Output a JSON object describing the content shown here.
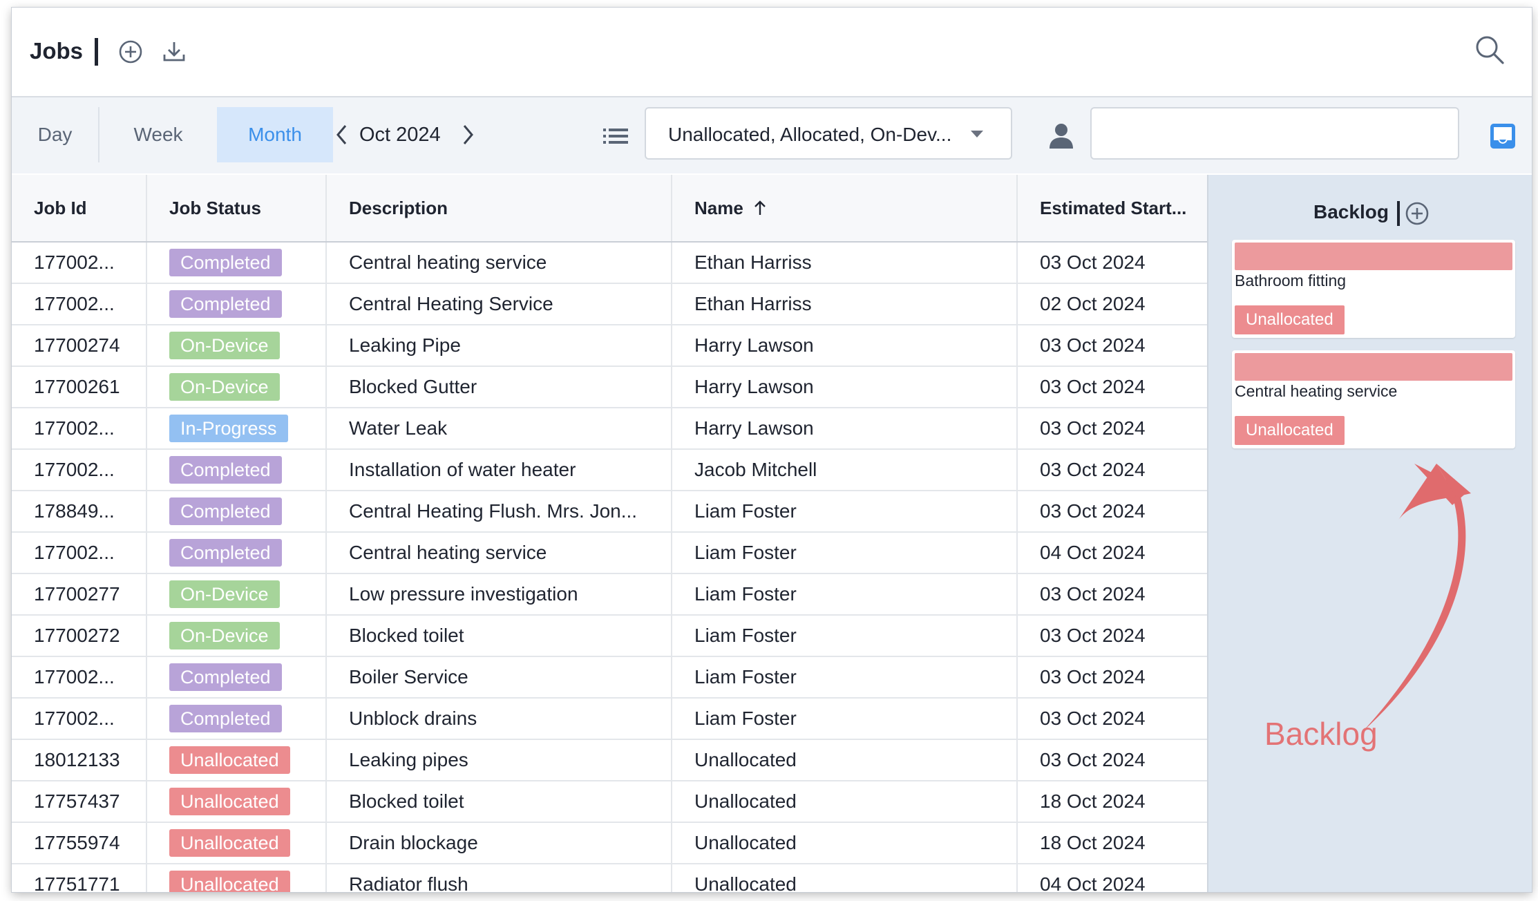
{
  "header": {
    "title": "Jobs",
    "icons": [
      "add-circle-icon",
      "download-icon",
      "search-icon"
    ]
  },
  "toolbar": {
    "views": [
      "Day",
      "Week",
      "Month"
    ],
    "selected_view": "Month",
    "period": "Oct 2024",
    "status_filter": "Unallocated, Allocated, On-Dev...",
    "search_value": "",
    "icons": [
      "chevron-left-icon",
      "chevron-right-icon",
      "list-icon",
      "user-icon",
      "inbox-icon"
    ]
  },
  "table": {
    "columns": [
      "Job Id",
      "Job Status",
      "Description",
      "Name",
      "Estimated Start..."
    ],
    "sort": {
      "column": "Name",
      "direction": "ascending"
    },
    "rows": [
      {
        "id": "177002...",
        "status": "Completed",
        "description": "Central heating service",
        "name": "Ethan Harriss",
        "start": "03 Oct 2024"
      },
      {
        "id": "177002...",
        "status": "Completed",
        "description": "Central Heating Service",
        "name": "Ethan Harriss",
        "start": "02 Oct 2024"
      },
      {
        "id": "17700274",
        "status": "On-Device",
        "description": "Leaking Pipe",
        "name": "Harry Lawson",
        "start": "03 Oct 2024"
      },
      {
        "id": "17700261",
        "status": "On-Device",
        "description": "Blocked Gutter",
        "name": "Harry Lawson",
        "start": "03 Oct 2024"
      },
      {
        "id": "177002...",
        "status": "In-Progress",
        "description": "Water Leak",
        "name": "Harry Lawson",
        "start": "03 Oct 2024"
      },
      {
        "id": "177002...",
        "status": "Completed",
        "description": "Installation of water heater",
        "name": "Jacob Mitchell",
        "start": "03 Oct 2024"
      },
      {
        "id": "178849...",
        "status": "Completed",
        "description": "Central Heating Flush. Mrs. Jon...",
        "name": "Liam Foster",
        "start": "03 Oct 2024"
      },
      {
        "id": "177002...",
        "status": "Completed",
        "description": "Central heating service",
        "name": "Liam Foster",
        "start": "04 Oct 2024"
      },
      {
        "id": "17700277",
        "status": "On-Device",
        "description": "Low pressure investigation",
        "name": "Liam Foster",
        "start": "03 Oct 2024"
      },
      {
        "id": "17700272",
        "status": "On-Device",
        "description": "Blocked toilet",
        "name": "Liam Foster",
        "start": "03 Oct 2024"
      },
      {
        "id": "177002...",
        "status": "Completed",
        "description": "Boiler Service",
        "name": "Liam Foster",
        "start": "03 Oct 2024"
      },
      {
        "id": "177002...",
        "status": "Completed",
        "description": "Unblock drains",
        "name": "Liam Foster",
        "start": "03 Oct 2024"
      },
      {
        "id": "18012133",
        "status": "Unallocated",
        "description": "Leaking pipes",
        "name": "Unallocated",
        "start": "03 Oct 2024"
      },
      {
        "id": "17757437",
        "status": "Unallocated",
        "description": "Blocked toilet",
        "name": "Unallocated",
        "start": "18 Oct 2024"
      },
      {
        "id": "17755974",
        "status": "Unallocated",
        "description": "Drain blockage",
        "name": "Unallocated",
        "start": "18 Oct 2024"
      },
      {
        "id": "17751771",
        "status": "Unallocated",
        "description": "Radiator flush",
        "name": "Unallocated",
        "start": "04 Oct 2024"
      }
    ]
  },
  "status_colors": {
    "Completed": "#b8a3d8",
    "On-Device": "#a6d49a",
    "In-Progress": "#93c0f2",
    "Unallocated": "#ec8c8f"
  },
  "backlog": {
    "title": "Backlog",
    "cards": [
      {
        "description": "Bathroom fitting",
        "status": "Unallocated"
      },
      {
        "description": "Central heating service",
        "status": "Unallocated"
      }
    ],
    "annotation": "Backlog"
  }
}
